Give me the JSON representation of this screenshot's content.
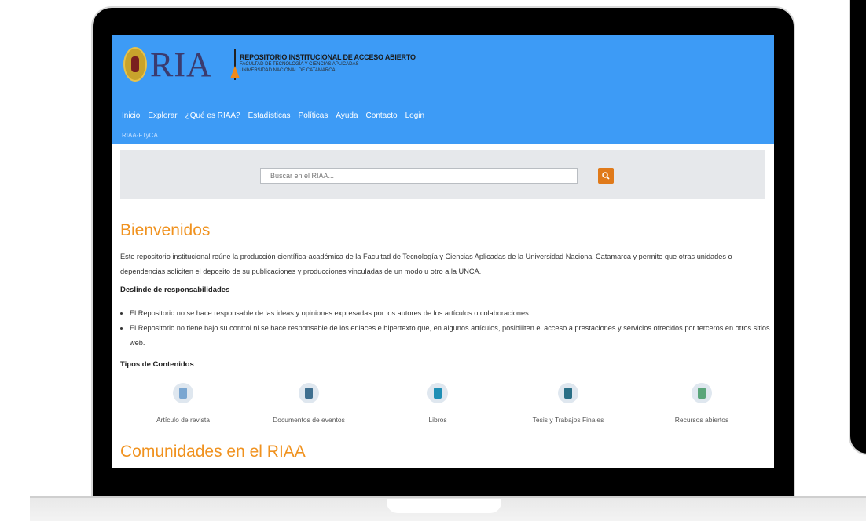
{
  "logo": {
    "mark": "RIA",
    "repository_title": "REPOSITORIO INSTITUCIONAL DE ACCESO ABIERTO",
    "faculty": "FACULTAD DE TECNOLOGÍA Y CIENCIAS APLICADAS",
    "university": "UNIVERSIDAD NACIONAL DE CATAMARCA"
  },
  "nav": {
    "items": [
      "Inicio",
      "Explorar",
      "¿Qué es RIAA?",
      "Estadísticas",
      "Políticas",
      "Ayuda",
      "Contacto",
      "Login"
    ]
  },
  "breadcrumb": "RIAA-FTyCA",
  "search": {
    "placeholder": "Buscar en el RIAA..."
  },
  "welcome": {
    "title": "Bienvenidos",
    "text": "Este repositorio institucional reúne la producción científica-académica de la Facultad de Tecnología y Ciencias Aplicadas de la Universidad Nacional Catamarca y permite que otras unidades o dependencias soliciten el deposito de su publicaciones y producciones vinculadas de un modo u otro a la UNCA."
  },
  "disclaimer": {
    "title": "Deslinde de responsabilidades",
    "items": [
      "El Repositorio no se hace responsable de las ideas y opiniones expresadas por los autores de los artículos o colaboraciones.",
      "El Repositorio no tiene bajo su control ni se hace responsable de los enlaces e hipertexto que, en algunos artículos, posibiliten el acceso a prestaciones y servicios ofrecidos por terceros en otros sitios web."
    ]
  },
  "content_types": {
    "title": "Tipos de Contenidos",
    "items": [
      {
        "label": "Artículo de revista",
        "icon": "journal-article-icon",
        "color": "#7aa6d1"
      },
      {
        "label": "Documentos de eventos",
        "icon": "event-documents-icon",
        "color": "#3f6f8f"
      },
      {
        "label": "Libros",
        "icon": "book-icon",
        "color": "#1f8fb5"
      },
      {
        "label": "Tesis y Trabajos Finales",
        "icon": "thesis-icon",
        "color": "#2a6f86"
      },
      {
        "label": "Recursos abiertos",
        "icon": "open-resources-icon",
        "color": "#5aa57a"
      }
    ]
  },
  "communities": {
    "title": "Comunidades en el RIAA"
  },
  "colors": {
    "header": "#3d9bf6",
    "accent": "#f0921f",
    "search_button": "#e07a1a"
  }
}
